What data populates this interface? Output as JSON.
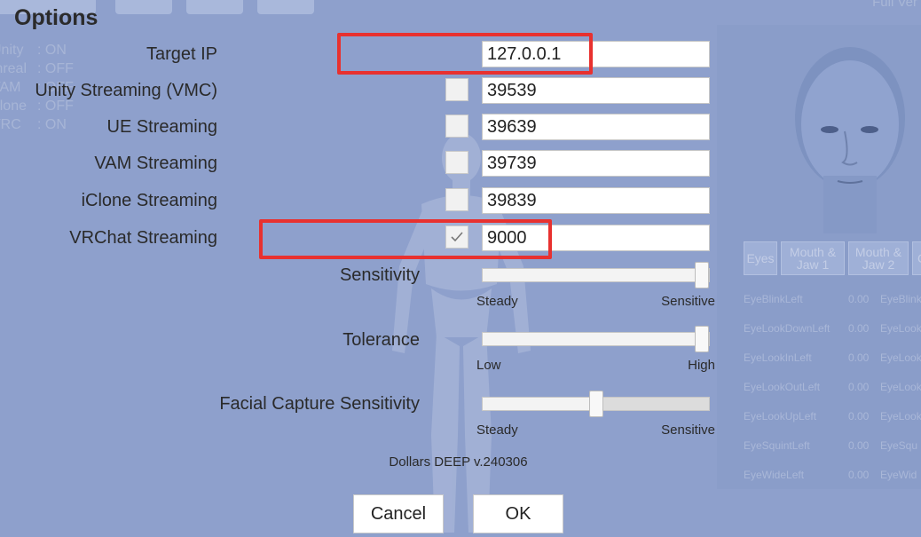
{
  "dialog": {
    "title": "Options"
  },
  "background": {
    "version_hint": "Full Ver",
    "status": [
      {
        "key": "Unity",
        "value": ": ON"
      },
      {
        "key": "Unreal",
        "value": ": OFF"
      },
      {
        "key": "VAM",
        "value": ": OFF"
      },
      {
        "key": "iClone",
        "value": ": OFF"
      },
      {
        "key": "VRC",
        "value": ": ON"
      }
    ],
    "tabs": [
      "Eyes",
      "Mouth & Jaw 1",
      "Mouth & Jaw 2",
      "Ch"
    ],
    "blendshapes": [
      {
        "name": "EyeBlinkLeft",
        "value": "0.00",
        "name2": "EyeBlink"
      },
      {
        "name": "EyeLookDownLeft",
        "value": "0.00",
        "name2": "EyeLook"
      },
      {
        "name": "EyeLookInLeft",
        "value": "0.00",
        "name2": "EyeLook"
      },
      {
        "name": "EyeLookOutLeft",
        "value": "0.00",
        "name2": "EyeLook"
      },
      {
        "name": "EyeLookUpLeft",
        "value": "0.00",
        "name2": "EyeLook"
      },
      {
        "name": "EyeSquintLeft",
        "value": "0.00",
        "name2": "EyeSqu"
      },
      {
        "name": "EyeWideLeft",
        "value": "0.00",
        "name2": "EyeWid"
      }
    ]
  },
  "options": {
    "target_ip": {
      "label": "Target IP",
      "value": "127.0.0.1"
    },
    "streams": [
      {
        "label": "Unity Streaming (VMC)",
        "checked": false,
        "port": "39539"
      },
      {
        "label": "UE Streaming",
        "checked": false,
        "port": "39639"
      },
      {
        "label": "VAM Streaming",
        "checked": false,
        "port": "39739"
      },
      {
        "label": "iClone Streaming",
        "checked": false,
        "port": "39839"
      },
      {
        "label": "VRChat Streaming",
        "checked": true,
        "port": "9000"
      }
    ],
    "sliders": [
      {
        "label": "Sensitivity",
        "min_label": "Steady",
        "max_label": "Sensitive",
        "value": 1.0
      },
      {
        "label": "Tolerance",
        "min_label": "Low",
        "max_label": "High",
        "value": 1.0
      },
      {
        "label": "Facial Capture Sensitivity",
        "min_label": "Steady",
        "max_label": "Sensitive",
        "value": 0.5
      }
    ],
    "version": "Dollars DEEP v.240306"
  },
  "buttons": {
    "cancel": "Cancel",
    "ok": "OK"
  },
  "colors": {
    "highlight": "#e8312f",
    "panel_bg": "#8ea1cb"
  }
}
